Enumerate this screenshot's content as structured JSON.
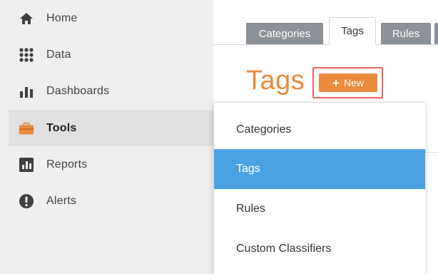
{
  "sidebar": {
    "items": [
      {
        "label": "Home",
        "icon": "home-icon"
      },
      {
        "label": "Data",
        "icon": "grid-dots-icon"
      },
      {
        "label": "Dashboards",
        "icon": "bar-chart-icon"
      },
      {
        "label": "Tools",
        "icon": "toolbox-icon",
        "active": true
      },
      {
        "label": "Reports",
        "icon": "report-chart-icon"
      },
      {
        "label": "Alerts",
        "icon": "alert-icon"
      }
    ]
  },
  "tabs": [
    {
      "label": "Categories"
    },
    {
      "label": "Tags",
      "active": true
    },
    {
      "label": "Rules"
    }
  ],
  "page": {
    "title": "Tags",
    "new_button_label": "New"
  },
  "dropdown": {
    "items": [
      {
        "label": "Categories"
      },
      {
        "label": "Tags",
        "selected": true
      },
      {
        "label": "Rules"
      },
      {
        "label": "Custom Classifiers"
      }
    ]
  },
  "colors": {
    "accent_orange": "#ea8a3c",
    "selected_blue": "#4ba3e3",
    "highlight_red": "#f2625c",
    "tab_gray": "#8b9196"
  }
}
